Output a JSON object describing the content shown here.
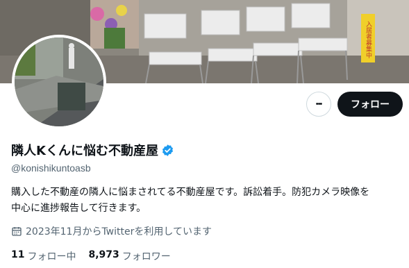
{
  "profile": {
    "display_name": "隣人Kくんに悩む不動産屋",
    "handle": "@konishikuntoasb",
    "bio_line1": "購入した不動産の隣人に悩まされてる不動産屋です。訴訟着手。防犯カメラ映像を",
    "bio_line2": "中心に進捗報告して行きます。",
    "joined": "2023年11月からTwitterを利用しています",
    "verified_icon": "verified-badge-icon",
    "accent_color": "#1d9bf0"
  },
  "actions": {
    "more_label": "•••",
    "follow_label": "フォロー"
  },
  "stats": {
    "following_count": "11",
    "following_label": "フォロー中",
    "followers_count": "8,973",
    "followers_label": "フォロワー"
  },
  "banner": {
    "sign_text": "入居者募集中"
  }
}
